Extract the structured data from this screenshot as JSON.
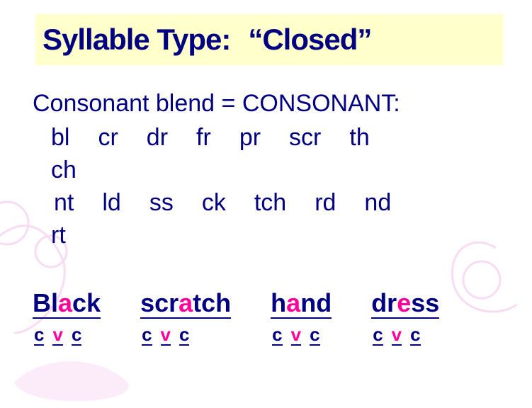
{
  "title": {
    "left": "Syllable Type:",
    "right": "“Closed”"
  },
  "subtitle": "Consonant blend = CONSONANT:",
  "row1": {
    "c0": "bl",
    "c1": "cr",
    "c2": "dr",
    "c3": "fr",
    "c4": "pr",
    "c5": "scr",
    "c6": "th"
  },
  "extra": "ch",
  "row2": {
    "c0": "nt",
    "c1": "ld",
    "c2": "ss",
    "c3": "ck",
    "c4": "tch",
    "c5": "rd",
    "c6": "nd"
  },
  "extra2": "rt",
  "words": {
    "w0": {
      "p0": "Bl",
      "v": "a",
      "p2": "ck",
      "g0": "c",
      "g1": "v",
      "g2": "c"
    },
    "w1": {
      "p0": "scr",
      "v": "a",
      "p2": "tch",
      "g0": "c",
      "g1": "v",
      "g2": "c"
    },
    "w2": {
      "p0": "h",
      "v": "a",
      "p2": "nd",
      "g0": "c",
      "g1": "v",
      "g2": "c"
    },
    "w3": {
      "p0": "dr",
      "v": "e",
      "p2": "ss",
      "g0": "c",
      "g1": "v",
      "g2": "c"
    }
  }
}
